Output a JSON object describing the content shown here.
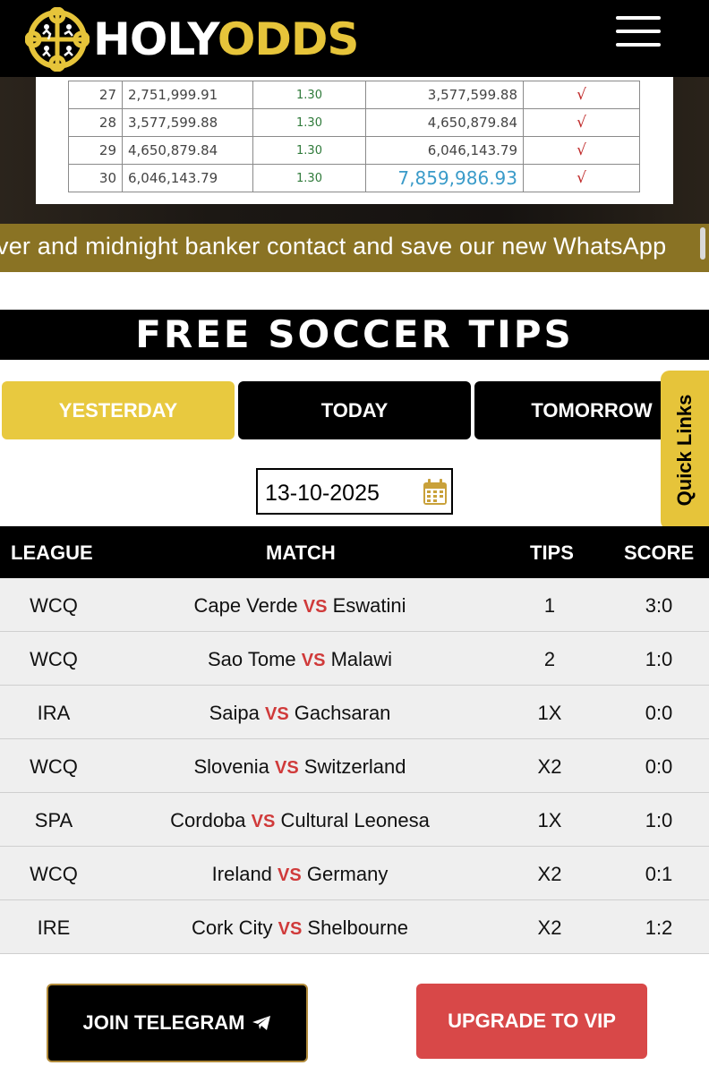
{
  "header": {
    "logo_holy": "HOLY",
    "logo_odds": "ODDS"
  },
  "banner_sheet": {
    "rows": [
      {
        "n": "27",
        "a": "2,751,999.91",
        "odds": "1.30",
        "r": "3,577,599.88",
        "check": "√"
      },
      {
        "n": "28",
        "a": "3,577,599.88",
        "odds": "1.30",
        "r": "4,650,879.84",
        "check": "√"
      },
      {
        "n": "29",
        "a": "4,650,879.84",
        "odds": "1.30",
        "r": "6,046,143.79",
        "check": "√"
      },
      {
        "n": "30",
        "a": "6,046,143.79",
        "odds": "1.30",
        "r": "7,859,986.93",
        "check": "√"
      }
    ]
  },
  "ticker": {
    "text": "ver and midnight banker contact and save our new WhatsApp"
  },
  "section": {
    "title": "FREE SOCCER TIPS"
  },
  "tabs": {
    "yesterday": "YESTERDAY",
    "today": "TODAY",
    "tomorrow": "TOMORROW"
  },
  "quick_links": "Quick Links",
  "date": {
    "value": "13-10-2025"
  },
  "table": {
    "headers": {
      "league": "LEAGUE",
      "match": "MATCH",
      "tips": "TIPS",
      "score": "SCORE"
    },
    "vs": "VS",
    "rows": [
      {
        "league": "WCQ",
        "home": "Cape Verde",
        "away": "Eswatini",
        "tip": "1",
        "score": "3:0"
      },
      {
        "league": "WCQ",
        "home": "Sao Tome",
        "away": "Malawi",
        "tip": "2",
        "score": "1:0"
      },
      {
        "league": "IRA",
        "home": "Saipa",
        "away": "Gachsaran",
        "tip": "1X",
        "score": "0:0"
      },
      {
        "league": "WCQ",
        "home": "Slovenia",
        "away": "Switzerland",
        "tip": "X2",
        "score": "0:0"
      },
      {
        "league": "SPA",
        "home": "Cordoba",
        "away": "Cultural Leonesa",
        "tip": "1X",
        "score": "1:0"
      },
      {
        "league": "WCQ",
        "home": "Ireland",
        "away": "Germany",
        "tip": "X2",
        "score": "0:1"
      },
      {
        "league": "IRE",
        "home": "Cork City",
        "away": "Shelbourne",
        "tip": "X2",
        "score": "1:2"
      }
    ]
  },
  "buttons": {
    "telegram": "JOIN TELEGRAM",
    "vip": "UPGRADE TO VIP"
  },
  "colors": {
    "brand_gold": "#e6c43a",
    "vs_red": "#d03a3a",
    "vip_red": "#d84848"
  },
  "icons": [
    "logo-badge-icon",
    "hamburger-menu-icon",
    "calendar-icon",
    "telegram-plane-icon"
  ]
}
